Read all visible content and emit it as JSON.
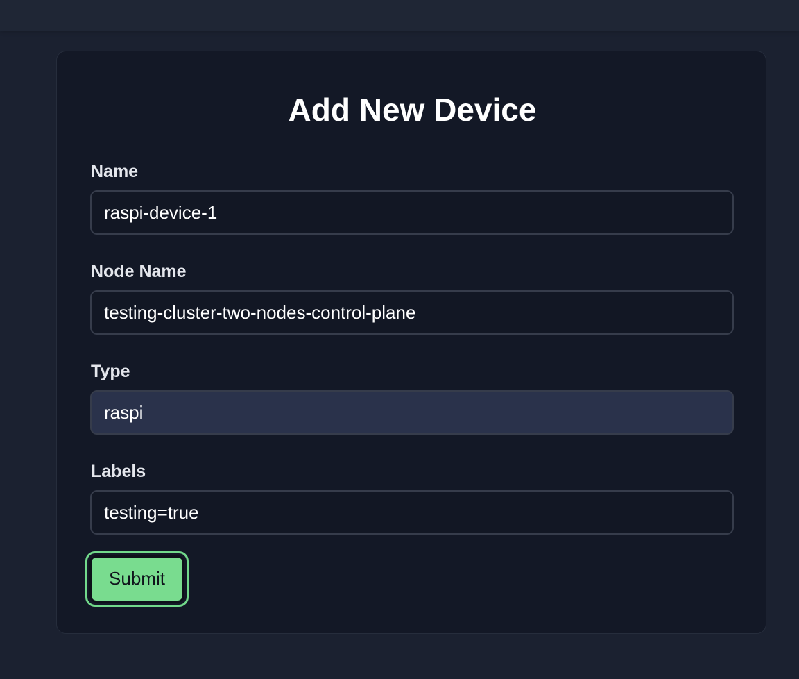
{
  "form": {
    "title": "Add New Device",
    "fields": [
      {
        "label": "Name",
        "value": "raspi-device-1"
      },
      {
        "label": "Node Name",
        "value": "testing-cluster-two-nodes-control-plane"
      },
      {
        "label": "Type",
        "value": "raspi"
      },
      {
        "label": "Labels",
        "value": "testing=true"
      }
    ],
    "submit_label": "Submit"
  },
  "colors": {
    "page_background": "#1b2130",
    "card_background": "#131826",
    "type_field_background": "#2a324b",
    "submit_background": "#79dc8f",
    "submit_focus_ring": "#72d98b"
  }
}
